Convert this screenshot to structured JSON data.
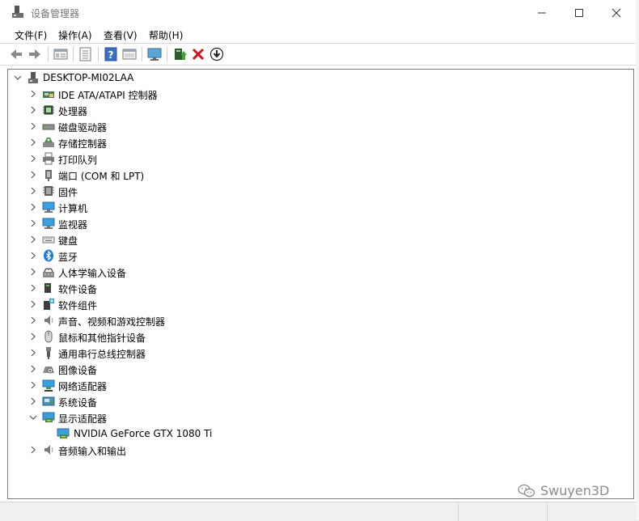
{
  "window": {
    "title": "设备管理器"
  },
  "menu": {
    "file": "文件(F)",
    "action": "操作(A)",
    "view": "查看(V)",
    "help": "帮助(H)"
  },
  "toolbar": {
    "icons": [
      "back-icon",
      "forward-icon",
      "properties-icon",
      "list-view-icon",
      "help-icon",
      "view-icon",
      "monitor-icon",
      "update-driver-icon",
      "uninstall-icon",
      "download-icon"
    ]
  },
  "tree": {
    "root": "DESKTOP-MI02LAA",
    "categories": [
      {
        "label": "IDE ATA/ATAPI 控制器",
        "icon": "ide-controller-icon"
      },
      {
        "label": "处理器",
        "icon": "processor-icon"
      },
      {
        "label": "磁盘驱动器",
        "icon": "disk-drive-icon"
      },
      {
        "label": "存储控制器",
        "icon": "storage-controller-icon"
      },
      {
        "label": "打印队列",
        "icon": "printer-icon"
      },
      {
        "label": "端口 (COM 和 LPT)",
        "icon": "port-icon"
      },
      {
        "label": "固件",
        "icon": "firmware-icon"
      },
      {
        "label": "计算机",
        "icon": "computer-icon"
      },
      {
        "label": "监视器",
        "icon": "monitor-icon"
      },
      {
        "label": "键盘",
        "icon": "keyboard-icon"
      },
      {
        "label": "蓝牙",
        "icon": "bluetooth-icon"
      },
      {
        "label": "人体学输入设备",
        "icon": "hid-icon"
      },
      {
        "label": "软件设备",
        "icon": "software-device-icon"
      },
      {
        "label": "软件组件",
        "icon": "software-component-icon"
      },
      {
        "label": "声音、视频和游戏控制器",
        "icon": "speaker-icon"
      },
      {
        "label": "鼠标和其他指针设备",
        "icon": "mouse-icon"
      },
      {
        "label": "通用串行总线控制器",
        "icon": "usb-icon"
      },
      {
        "label": "图像设备",
        "icon": "camera-icon"
      },
      {
        "label": "网络适配器",
        "icon": "network-adapter-icon"
      },
      {
        "label": "系统设备",
        "icon": "system-device-icon"
      },
      {
        "label": "显示适配器",
        "icon": "display-adapter-icon",
        "expanded": true
      },
      {
        "label": "NVIDIA GeForce GTX 1080 Ti",
        "icon": "display-adapter-icon",
        "child": true
      },
      {
        "label": "音频输入和输出",
        "icon": "speaker-icon"
      }
    ]
  },
  "watermark": {
    "text": "Swuyen3D",
    "icon": "wechat-icon"
  }
}
